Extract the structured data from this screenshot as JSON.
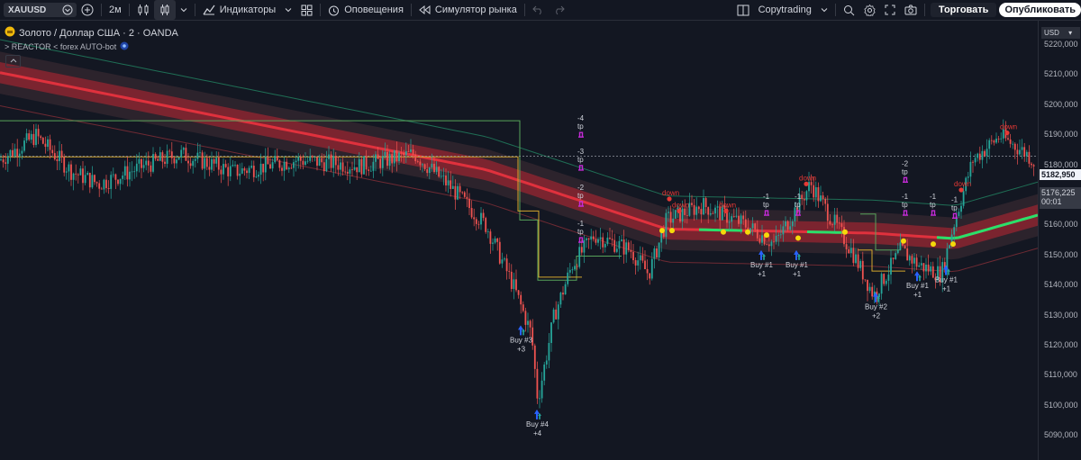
{
  "toolbar": {
    "symbol": "XAUUSD",
    "interval": "2м",
    "indicators_label": "Индикаторы",
    "alerts_label": "Оповещения",
    "replay_label": "Симулятор рынка",
    "copytrading_label": "Copytrading",
    "trade_label": "Торговать",
    "publish_label": "Опубликовать"
  },
  "legend": {
    "title": "Золото / Доллар США · 2 · OANDA",
    "indicator": "> REACTOR < forex AUTO-bot"
  },
  "price_axis": {
    "currency": "USD",
    "ticks": [
      "5220,000",
      "5210,000",
      "5200,000",
      "5190,000",
      "5180,000",
      "5170,000",
      "5160,000",
      "5150,000",
      "5140,000",
      "5130,000",
      "5120,000",
      "5110,000",
      "5100,000",
      "5090,000"
    ],
    "last_price": "5182,950",
    "crosshair_price": "5176,225",
    "countdown": "00:01"
  },
  "colors": {
    "background": "#131722",
    "up_candle": "#26a69a",
    "down_candle": "#ef5350",
    "band_red": "#e0313d",
    "band_green": "#29e06a",
    "signal_yellow": "#f5d90a",
    "buy_arrow": "#2962ff",
    "tp_marker": "#c42bd6",
    "down_label": "#e53935"
  },
  "annotations": {
    "buy_labels": [
      {
        "label": "Buy #3",
        "count": "+3"
      },
      {
        "label": "Buy #4",
        "count": "+4"
      },
      {
        "label": "Buy #1",
        "count": "+1"
      },
      {
        "label": "Buy #1",
        "count": "+1"
      },
      {
        "label": "Buy #2",
        "count": "+2"
      },
      {
        "label": "Buy #1",
        "count": "+1"
      },
      {
        "label": "Buy #1",
        "count": "+1"
      }
    ],
    "tp_labels": [
      {
        "num": "-4",
        "text": "tp"
      },
      {
        "num": "-3",
        "text": "tp"
      },
      {
        "num": "-2",
        "text": "tp"
      },
      {
        "num": "-1",
        "text": "tp"
      },
      {
        "num": "-1",
        "text": "tp"
      },
      {
        "num": "-1",
        "text": "tp"
      },
      {
        "num": "-2",
        "text": "tp"
      },
      {
        "num": "-1",
        "text": "tp"
      },
      {
        "num": "-1",
        "text": "tp"
      },
      {
        "num": "-1",
        "text": "tp"
      }
    ],
    "down_labels": [
      "down",
      "down",
      "down",
      "down",
      "down",
      "down"
    ]
  }
}
